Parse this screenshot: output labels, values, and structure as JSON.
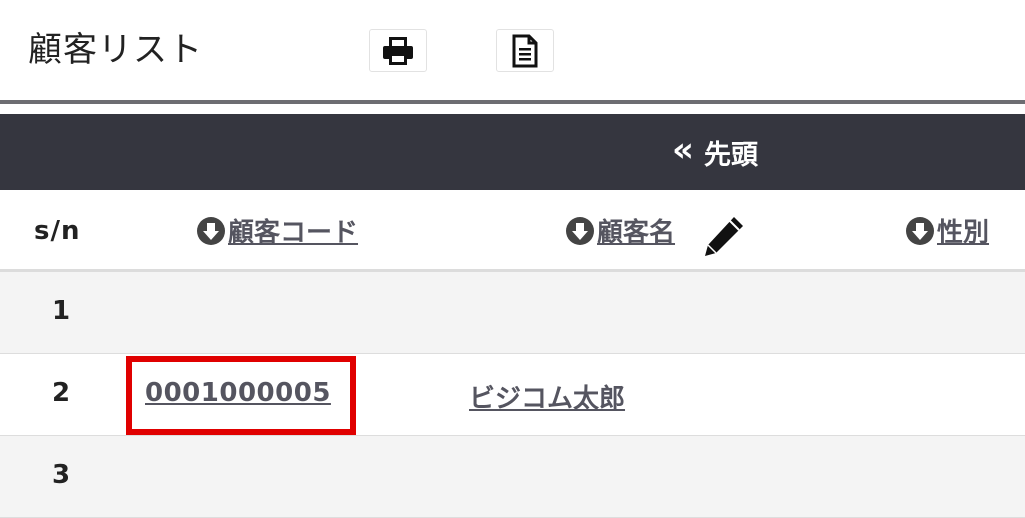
{
  "header": {
    "title": "顧客リスト",
    "print_icon": "print-icon",
    "document_icon": "document-icon"
  },
  "pager": {
    "first_label": "先頭",
    "first_icon_glyph": "«"
  },
  "table": {
    "columns": {
      "sn": "s/n",
      "code": "顧客コード",
      "name": "顧客名",
      "gender": "性別"
    },
    "rows": [
      {
        "num": "1",
        "code": "",
        "name": ""
      },
      {
        "num": "2",
        "code": "0001000005",
        "name": "ビジコム太郎"
      },
      {
        "num": "3",
        "code": "",
        "name": ""
      }
    ]
  },
  "colors": {
    "pager_bg": "#35363f",
    "divider": "#6d6d72",
    "link": "#555560",
    "highlight": "#e00000"
  }
}
